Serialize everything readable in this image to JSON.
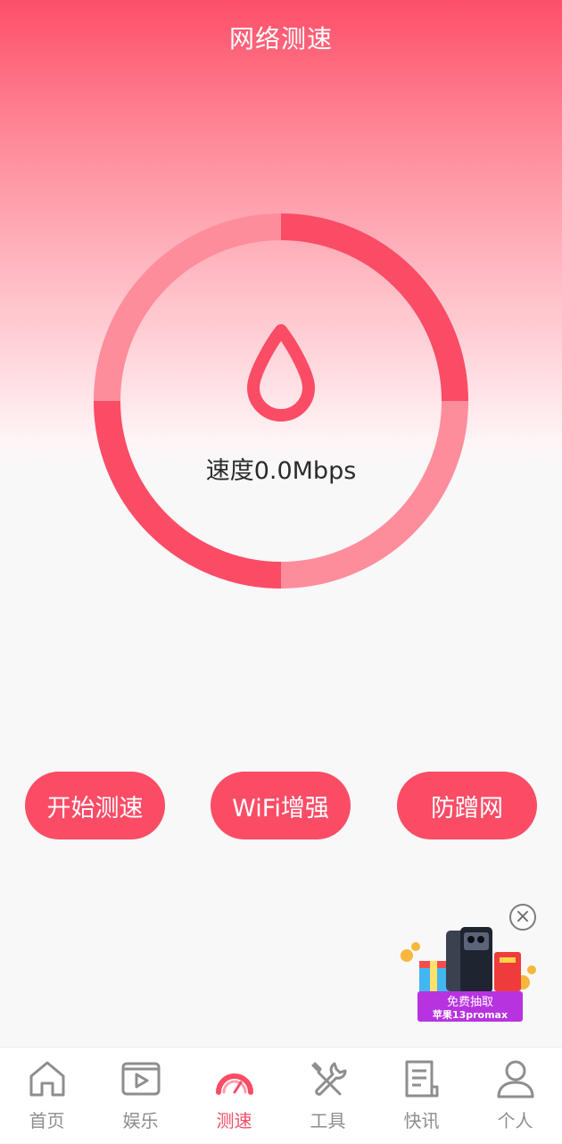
{
  "header": {
    "title": "网络测速"
  },
  "gauge": {
    "speed_text": "速度0.0Mbps"
  },
  "actions": [
    {
      "label": "开始测速"
    },
    {
      "label": "WiFi增强"
    },
    {
      "label": "防蹭网"
    }
  ],
  "ad": {
    "line1": "免费抽取",
    "line2": "苹果13promax",
    "close_glyph": "×"
  },
  "tabbar": {
    "items": [
      {
        "label": "首页",
        "icon": "home-icon",
        "active": false
      },
      {
        "label": "娱乐",
        "icon": "video-icon",
        "active": false
      },
      {
        "label": "测速",
        "icon": "speedometer-icon",
        "active": true
      },
      {
        "label": "工具",
        "icon": "tools-icon",
        "active": false
      },
      {
        "label": "快讯",
        "icon": "news-icon",
        "active": false
      },
      {
        "label": "个人",
        "icon": "person-icon",
        "active": false
      }
    ]
  },
  "colors": {
    "accent": "#fb4c66",
    "accent_light": "#fe8d9c",
    "tab_inactive": "#8e8e8e"
  }
}
